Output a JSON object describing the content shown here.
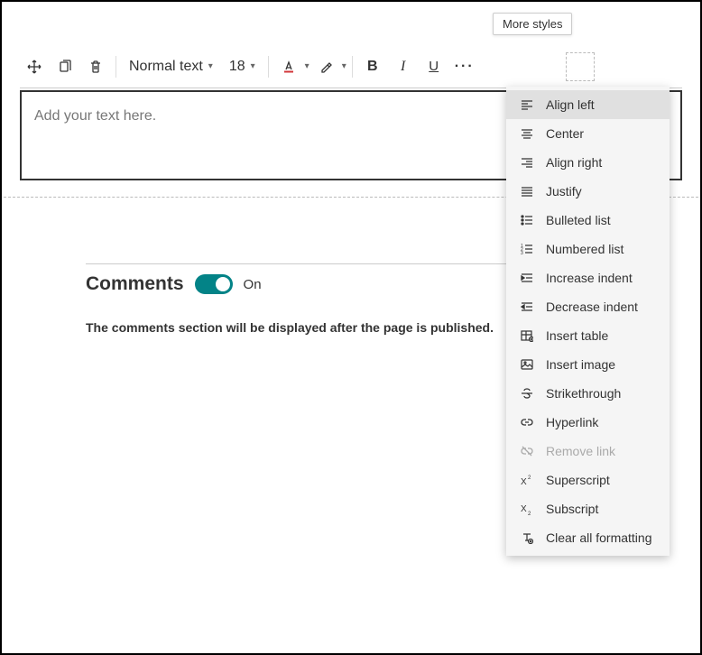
{
  "tooltip": "More styles",
  "toolbar": {
    "style_select": "Normal text",
    "font_size": "18"
  },
  "editor": {
    "placeholder": "Add your text here."
  },
  "comments": {
    "title": "Comments",
    "toggle_label": "On",
    "info": "The comments section will be displayed after the page is published."
  },
  "menu": {
    "items": [
      {
        "label": "Align left"
      },
      {
        "label": "Center"
      },
      {
        "label": "Align right"
      },
      {
        "label": "Justify"
      },
      {
        "label": "Bulleted list"
      },
      {
        "label": "Numbered list"
      },
      {
        "label": "Increase indent"
      },
      {
        "label": "Decrease indent"
      },
      {
        "label": "Insert table"
      },
      {
        "label": "Insert image"
      },
      {
        "label": "Strikethrough"
      },
      {
        "label": "Hyperlink"
      },
      {
        "label": "Remove link"
      },
      {
        "label": "Superscript"
      },
      {
        "label": "Subscript"
      },
      {
        "label": "Clear all formatting"
      }
    ]
  }
}
